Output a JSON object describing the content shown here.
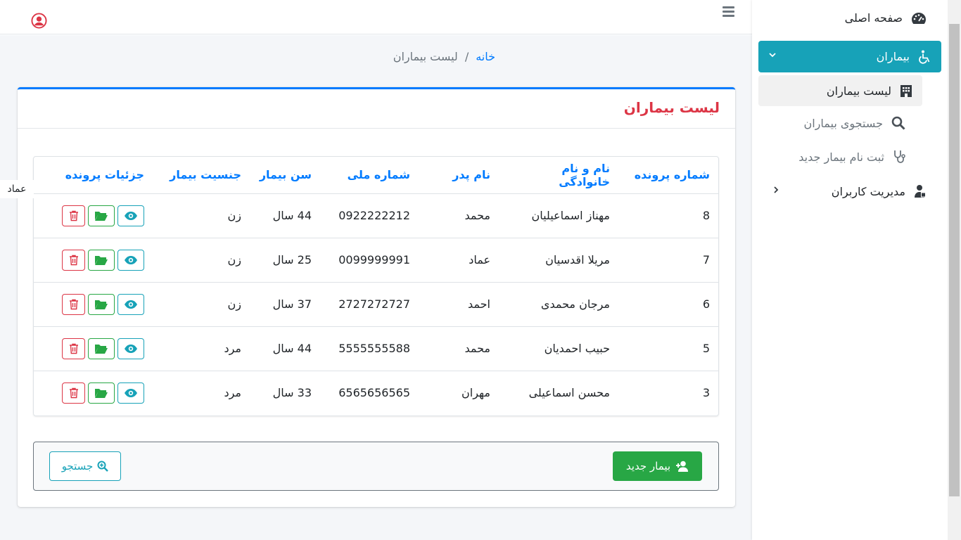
{
  "breadcrumb": {
    "home": "خانه",
    "separator": "/",
    "current": "لیست بیماران"
  },
  "card": {
    "title": "لیست بیماران"
  },
  "table": {
    "headers": [
      "شماره پرونده",
      "نام و نام خانوادگی",
      "نام پدر",
      "شماره ملی",
      "سن بیمار",
      "جنسیت بیمار",
      "جزئیات پرونده"
    ],
    "rows": [
      {
        "id": "8",
        "name": "مهناز اسماعیلیان",
        "father": "محمد",
        "national_id": "0922222212",
        "age": "44 سال",
        "gender": "زن"
      },
      {
        "id": "7",
        "name": "مریلا اقدسیان",
        "father": "عماد",
        "national_id": "0099999991",
        "age": "25 سال",
        "gender": "زن"
      },
      {
        "id": "6",
        "name": "مرجان محمدی",
        "father": "احمد",
        "national_id": "2727272727",
        "age": "37 سال",
        "gender": "زن"
      },
      {
        "id": "5",
        "name": "حبیب احمدیان",
        "father": "محمد",
        "national_id": "5555555588",
        "age": "44 سال",
        "gender": "مرد"
      },
      {
        "id": "3",
        "name": "محسن اسماعیلی",
        "father": "مهران",
        "national_id": "6565656565",
        "age": "33 سال",
        "gender": "مرد"
      }
    ]
  },
  "footer": {
    "new_patient": "بیمار جدید",
    "search": "جستجو"
  },
  "floating_label": "عماد",
  "sidebar": {
    "home": "صفحه اصلی",
    "patients": "بیماران",
    "patients_list": "لیست بیماران",
    "patients_search": "جستجوی بیماران",
    "patients_register": "ثبت نام بیمار جدید",
    "user_management": "مدیریت کاربران"
  },
  "colors": {
    "primary": "#007bff",
    "info": "#17a2b8",
    "success": "#28a745",
    "danger": "#dc3545"
  },
  "icons": [
    "user-circle-icon",
    "hamburger-icon",
    "tachometer-icon",
    "wheelchair-icon",
    "hospital-icon",
    "search-icon",
    "stethoscope-icon",
    "user-shield-icon",
    "eye-icon",
    "folder-open-icon",
    "trash-icon",
    "user-plus-icon",
    "search-plus-icon",
    "chevron-down-icon",
    "chevron-right-icon"
  ]
}
